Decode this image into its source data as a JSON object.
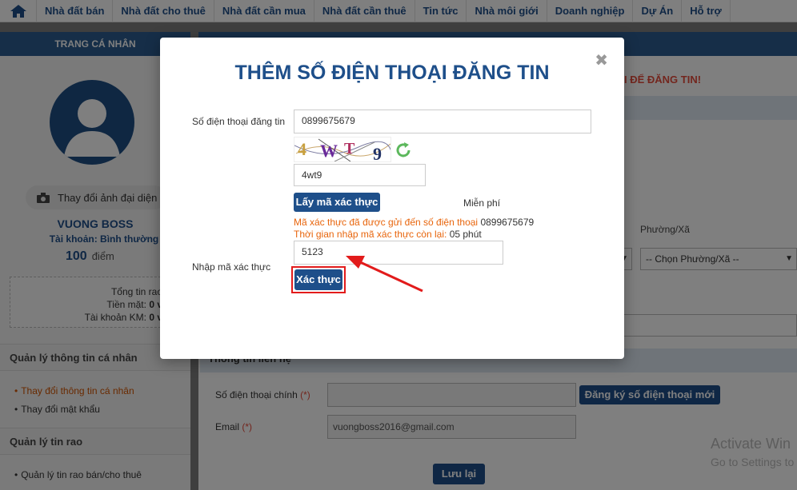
{
  "nav": {
    "items": [
      "Nhà đất bán",
      "Nhà đất cho thuê",
      "Nhà đất cần mua",
      "Nhà đất cần thuê",
      "Tin tức",
      "Nhà môi giới",
      "Doanh nghiệp",
      "Dự Án",
      "Hỗ trợ"
    ]
  },
  "profile": {
    "header": "TRANG CÁ NHÂN",
    "change_photo": "Thay đổi ảnh đại diện",
    "name": "VUONG BOSS",
    "account_type": "Tài khoản: Bình thường",
    "points_value": "100",
    "points_unit": "điểm",
    "stats": {
      "total_label": "Tổng tin rao",
      "cash_label": "Tiền mặt:",
      "cash_value": "0 v",
      "promo_label": "Tài khoản KM:",
      "promo_value": "0 v"
    }
  },
  "sidebar": {
    "section1": "Quản lý thông tin cá nhân",
    "links1": [
      "Thay đổi thông tin cá nhân",
      "Thay đổi mật khẩu"
    ],
    "section2": "Quản lý tin rao",
    "links2": [
      "Quản lý tin rao bán/cho thuê"
    ]
  },
  "main": {
    "warning": "I ĐỂ ĐĂNG TIN!",
    "ward_label": "Phường/Xã",
    "ward_placeholder": "-- Chọn Phường/Xã --",
    "contact_header": "Thông tin liên hệ",
    "phone_label": "Số điện thoại chính",
    "required_mark": "(*)",
    "register_phone_button": "Đăng ký số điện thoại mới",
    "email_label": "Email",
    "email_value": "vuongboss2016@gmail.com",
    "save_button": "Lưu lại"
  },
  "windows_watermark": {
    "line1": "Activate Win",
    "line2": "Go to Settings to"
  },
  "modal": {
    "title": "THÊM SỐ ĐIỆN THOẠI ĐĂNG TIN",
    "close": "✖",
    "phone_label": "Số điện thoại đăng tin",
    "phone_value": "0899675679",
    "captcha_text": "4WT9",
    "captcha_input": "4wt9",
    "get_code_button": "Lấy mã xác thực",
    "free_label": "Miễn phí",
    "sent_notice": "Mã xác thực đã được gửi đến số điện thoại",
    "sent_phone": "0899675679",
    "time_notice": "Thời gian nhập mã xác thực còn lại:",
    "time_value": "05 phút",
    "code_label": "Nhập mã xác thực",
    "code_value": "5123",
    "verify_button": "Xác thực"
  },
  "colors": {
    "brand_blue": "#1e4f8a",
    "notice_orange": "#e8650c",
    "highlight_red": "#e21b1b"
  }
}
